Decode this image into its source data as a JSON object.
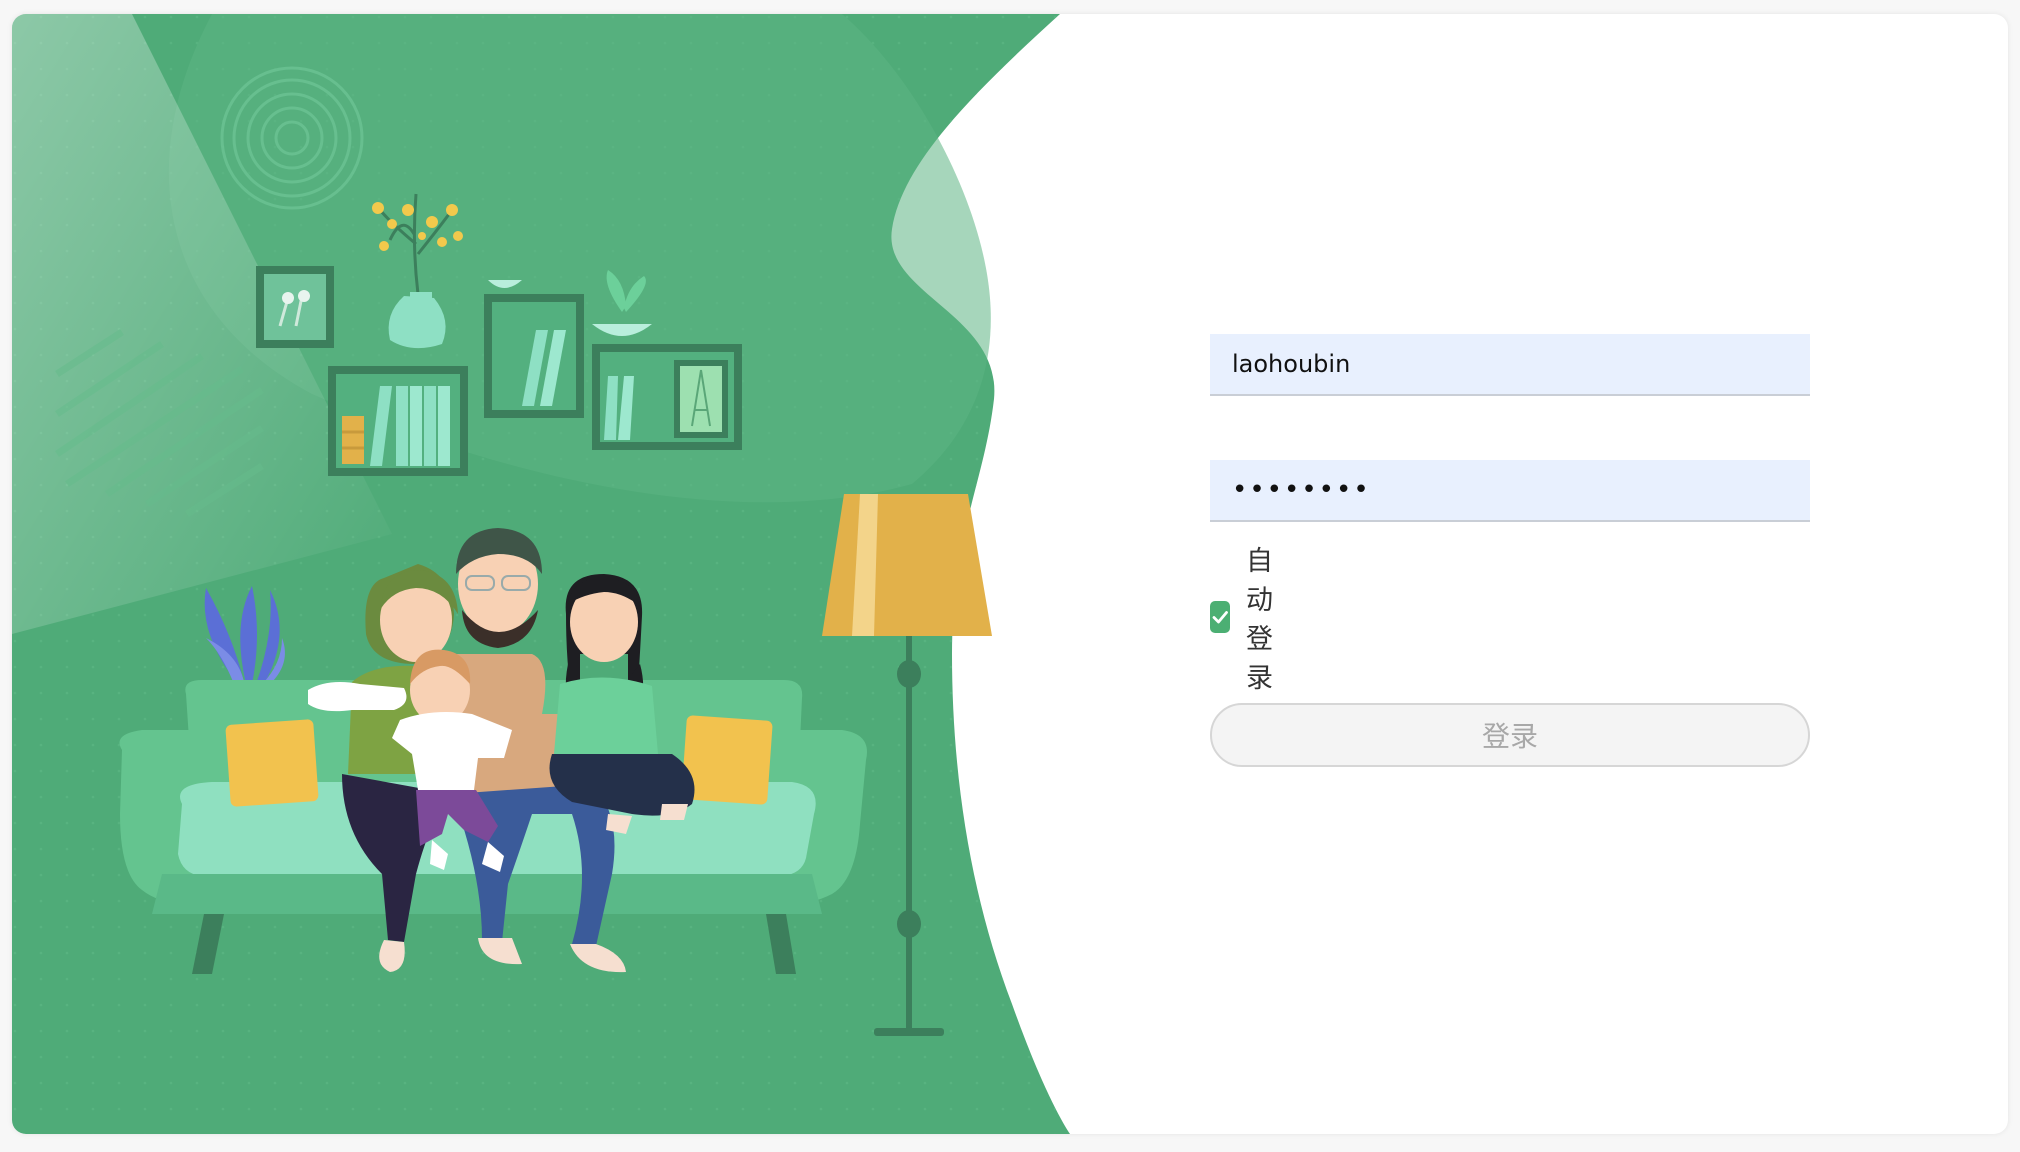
{
  "login_form": {
    "username_value": "laohoubin",
    "password_value": "••••••••",
    "remember_label": "自动登录",
    "remember_checked": true,
    "submit_label": "登录"
  },
  "colors": {
    "hero_green": "#4fab78",
    "accent_green": "#4caf73",
    "input_background": "#e8f0fe",
    "lamp_yellow": "#e2b14a"
  },
  "icons": {
    "checkbox": "checkmark-icon"
  }
}
